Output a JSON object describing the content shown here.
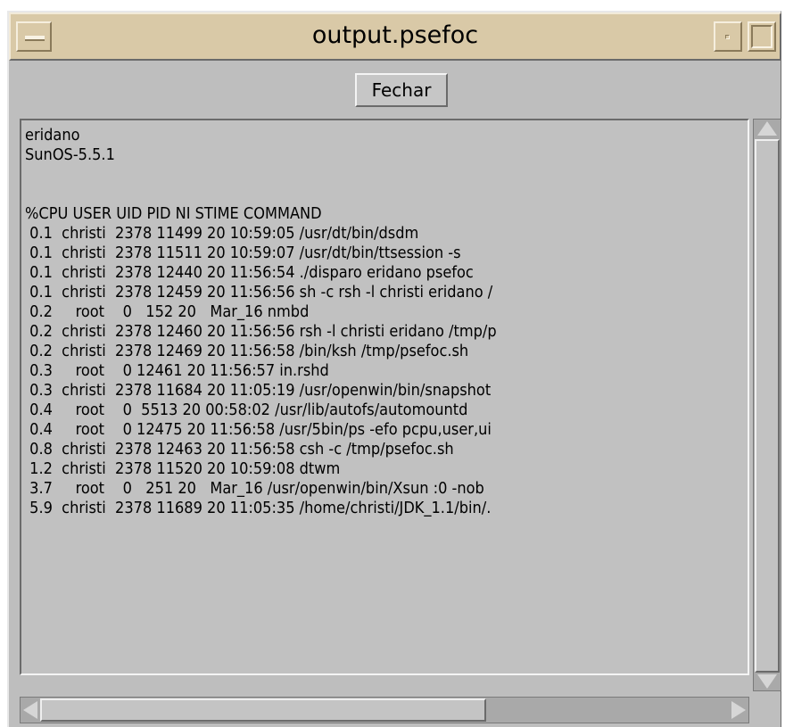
{
  "window": {
    "title": "output.psefoc",
    "colors": {
      "titlebar": "#d9c9a7",
      "background": "#bebebe"
    }
  },
  "buttons": {
    "close_label": "Fechar"
  },
  "output": {
    "lines": [
      "eridano",
      "SunOS-5.5.1",
      "",
      "",
      "%CPU USER UID PID NI STIME COMMAND",
      " 0.1  christi  2378 11499 20 10:59:05 /usr/dt/bin/dsdm",
      " 0.1  christi  2378 11511 20 10:59:07 /usr/dt/bin/ttsession -s",
      " 0.1  christi  2378 12440 20 11:56:54 ./disparo eridano psefoc",
      " 0.1  christi  2378 12459 20 11:56:56 sh -c rsh -l christi eridano /",
      " 0.2     root    0   152 20   Mar_16 nmbd",
      " 0.2  christi  2378 12460 20 11:56:56 rsh -l christi eridano /tmp/p",
      " 0.2  christi  2378 12469 20 11:56:58 /bin/ksh /tmp/psefoc.sh",
      " 0.3     root    0 12461 20 11:56:57 in.rshd",
      " 0.3  christi  2378 11684 20 11:05:19 /usr/openwin/bin/snapshot",
      " 0.4     root    0  5513 20 00:58:02 /usr/lib/autofs/automountd",
      " 0.4     root    0 12475 20 11:56:58 /usr/5bin/ps -efo pcpu,user,ui",
      " 0.8  christi  2378 12463 20 11:56:58 csh -c /tmp/psefoc.sh",
      " 1.2  christi  2378 11520 20 10:59:08 dtwm",
      " 3.7     root    0   251 20   Mar_16 /usr/openwin/bin/Xsun :0 -nob",
      " 5.9  christi  2378 11689 20 11:05:35 /home/christi/JDK_1.1/bin/."
    ]
  }
}
